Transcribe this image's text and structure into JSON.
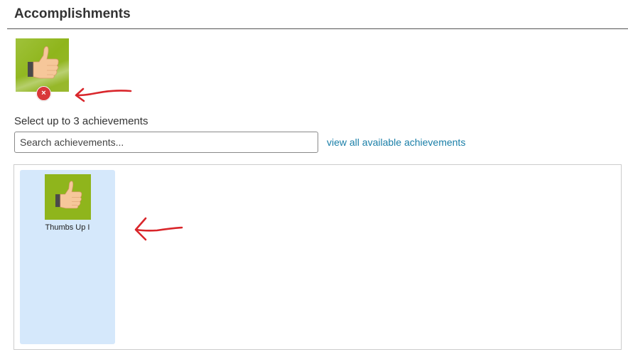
{
  "header": {
    "title": "Accomplishments"
  },
  "selected": {
    "items": [
      {
        "icon": "thumbs-up-icon",
        "remove_symbol": "×",
        "badge_color": "#8fb51c"
      }
    ]
  },
  "picker": {
    "instruction": "Select up to 3 achievements",
    "search_placeholder": "Search achievements...",
    "search_value": "",
    "view_all_link": "view all available achievements"
  },
  "results": {
    "items": [
      {
        "label": "Thumbs Up I",
        "icon": "thumbs-up-icon",
        "selected": true
      }
    ]
  },
  "colors": {
    "link": "#1a7fa8",
    "selected_card": "#d5e8fb",
    "remove_button": "#d9383a",
    "annotation_arrow": "#d9262b"
  }
}
